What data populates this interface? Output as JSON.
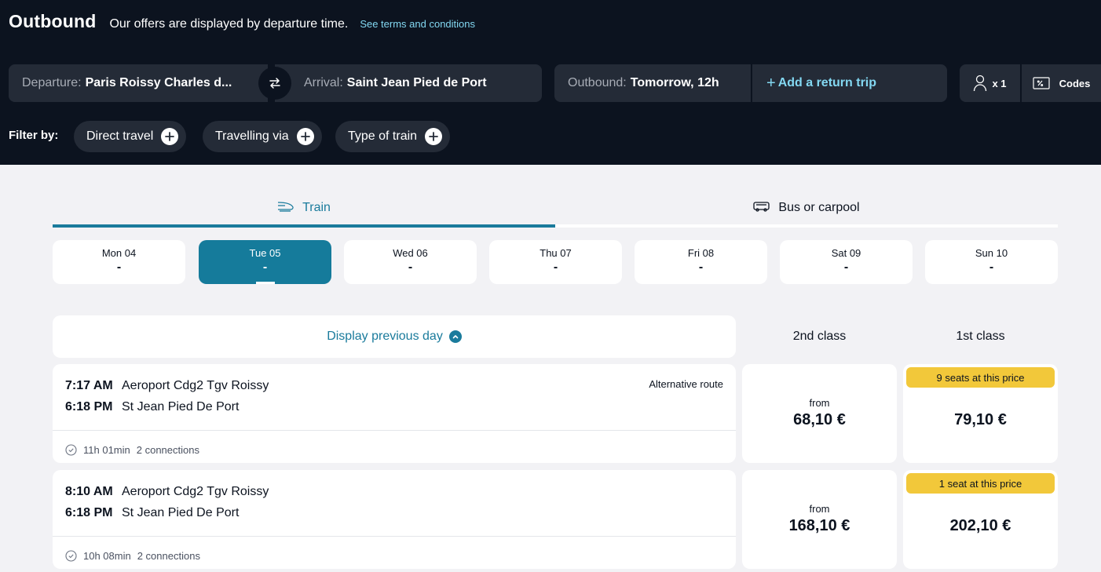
{
  "header": {
    "title": "Outbound",
    "subtitle": "Our offers are displayed by departure time.",
    "terms_link": "See terms and conditions"
  },
  "search": {
    "departure_label": "Departure:",
    "departure_value": "Paris Roissy Charles d...",
    "arrival_label": "Arrival:",
    "arrival_value": "Saint Jean Pied  de Port",
    "outbound_label": "Outbound:",
    "outbound_value": "Tomorrow, 12h",
    "return_label": "Add a return trip",
    "passengers": "x 1",
    "codes_label": "Codes"
  },
  "filters": {
    "label": "Filter by:",
    "chips": [
      "Direct travel",
      "Travelling via",
      "Type of train"
    ]
  },
  "tabs": [
    {
      "label": "Train",
      "icon": "train-icon",
      "active": true
    },
    {
      "label": "Bus or carpool",
      "icon": "bus-icon",
      "active": false
    }
  ],
  "days": [
    {
      "name": "Mon 04",
      "value": "-"
    },
    {
      "name": "Tue 05",
      "value": "-",
      "active": true
    },
    {
      "name": "Wed 06",
      "value": "-"
    },
    {
      "name": "Thu 07",
      "value": "-"
    },
    {
      "name": "Fri 08",
      "value": "-"
    },
    {
      "name": "Sat 09",
      "value": "-"
    },
    {
      "name": "Sun 10",
      "value": "-"
    }
  ],
  "results": {
    "prev_day_label": "Display previous day",
    "class2_label": "2nd class",
    "class1_label": "1st class",
    "trips": [
      {
        "dep_time": "7:17 AM",
        "dep_station": "Aeroport Cdg2 Tgv Roissy",
        "arr_time": "6:18 PM",
        "arr_station": "St Jean Pied De Port",
        "tag": "Alternative route",
        "duration": "11h 01min",
        "connections": "2 connections",
        "class2_from": "from",
        "class2_price": "68,10 €",
        "class1_badge": "9 seats at this price",
        "class1_price": "79,10 €"
      },
      {
        "dep_time": "8:10 AM",
        "dep_station": "Aeroport Cdg2 Tgv Roissy",
        "arr_time": "6:18 PM",
        "arr_station": "St Jean Pied De Port",
        "tag": "",
        "duration": "10h 08min",
        "connections": "2 connections",
        "class2_from": "from",
        "class2_price": "168,10 €",
        "class1_badge": "1 seat at this price",
        "class1_price": "202,10 €"
      }
    ]
  },
  "colors": {
    "header_bg": "#0c131f",
    "field_bg": "#242b37",
    "accent": "#157b9b",
    "link": "#83d8f2",
    "badge": "#f2c83a"
  }
}
